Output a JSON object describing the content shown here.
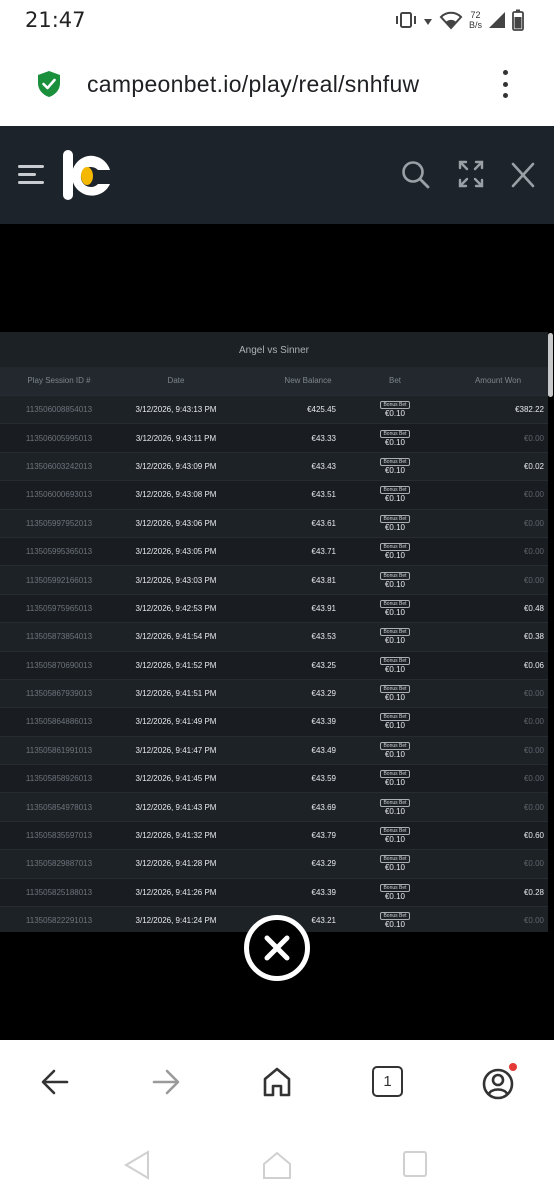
{
  "status": {
    "time": "21:47",
    "net_speed_top": "72",
    "net_speed_bottom": "B/s"
  },
  "browser": {
    "url": "campeonbet.io/play/real/snhfuw"
  },
  "modal": {
    "title": "Angel vs Sinner",
    "columns": [
      "Play Session ID #",
      "Date",
      "New Balance",
      "Bet",
      "Amount Won"
    ],
    "badge_label": "Bonus Bet",
    "rows": [
      {
        "id": "113506008854013",
        "date": "3/12/2026, 9:43:13 PM",
        "balance": "€425.45",
        "bet": "€0.10",
        "won": "€382.22"
      },
      {
        "id": "113506005995013",
        "date": "3/12/2026, 9:43:11 PM",
        "balance": "€43.33",
        "bet": "€0.10",
        "won": "€0.00"
      },
      {
        "id": "113506003242013",
        "date": "3/12/2026, 9:43:09 PM",
        "balance": "€43.43",
        "bet": "€0.10",
        "won": "€0.02"
      },
      {
        "id": "113506000693013",
        "date": "3/12/2026, 9:43:08 PM",
        "balance": "€43.51",
        "bet": "€0.10",
        "won": "€0.00"
      },
      {
        "id": "113505997952013",
        "date": "3/12/2026, 9:43:06 PM",
        "balance": "€43.61",
        "bet": "€0.10",
        "won": "€0.00"
      },
      {
        "id": "113505995365013",
        "date": "3/12/2026, 9:43:05 PM",
        "balance": "€43.71",
        "bet": "€0.10",
        "won": "€0.00"
      },
      {
        "id": "113505992166013",
        "date": "3/12/2026, 9:43:03 PM",
        "balance": "€43.81",
        "bet": "€0.10",
        "won": "€0.00"
      },
      {
        "id": "113505975965013",
        "date": "3/12/2026, 9:42:53 PM",
        "balance": "€43.91",
        "bet": "€0.10",
        "won": "€0.48"
      },
      {
        "id": "113505873854013",
        "date": "3/12/2026, 9:41:54 PM",
        "balance": "€43.53",
        "bet": "€0.10",
        "won": "€0.38"
      },
      {
        "id": "113505870690013",
        "date": "3/12/2026, 9:41:52 PM",
        "balance": "€43.25",
        "bet": "€0.10",
        "won": "€0.06"
      },
      {
        "id": "113505867939013",
        "date": "3/12/2026, 9:41:51 PM",
        "balance": "€43.29",
        "bet": "€0.10",
        "won": "€0.00"
      },
      {
        "id": "113505864886013",
        "date": "3/12/2026, 9:41:49 PM",
        "balance": "€43.39",
        "bet": "€0.10",
        "won": "€0.00"
      },
      {
        "id": "113505861991013",
        "date": "3/12/2026, 9:41:47 PM",
        "balance": "€43.49",
        "bet": "€0.10",
        "won": "€0.00"
      },
      {
        "id": "113505858926013",
        "date": "3/12/2026, 9:41:45 PM",
        "balance": "€43.59",
        "bet": "€0.10",
        "won": "€0.00"
      },
      {
        "id": "113505854978013",
        "date": "3/12/2026, 9:41:43 PM",
        "balance": "€43.69",
        "bet": "€0.10",
        "won": "€0.00"
      },
      {
        "id": "113505835597013",
        "date": "3/12/2026, 9:41:32 PM",
        "balance": "€43.79",
        "bet": "€0.10",
        "won": "€0.60"
      },
      {
        "id": "113505829887013",
        "date": "3/12/2026, 9:41:28 PM",
        "balance": "€43.29",
        "bet": "€0.10",
        "won": "€0.00"
      },
      {
        "id": "113505825188013",
        "date": "3/12/2026, 9:41:26 PM",
        "balance": "€43.39",
        "bet": "€0.10",
        "won": "€0.28"
      },
      {
        "id": "113505822291013",
        "date": "3/12/2026, 9:41:24 PM",
        "balance": "€43.21",
        "bet": "€0.10",
        "won": "€0.00"
      }
    ]
  },
  "colors": {
    "header_bg": "#1d232a",
    "logo_accent": "#f5b800",
    "shield_green": "#1a8f3c",
    "notify_dot": "#e53935"
  },
  "icons": [
    "wifi-icon",
    "vibrate-icon",
    "battery-icon",
    "shield-check-icon",
    "kebab-menu-icon",
    "hamburger-icon",
    "search-icon",
    "expand-icon",
    "close-icon",
    "back-icon",
    "forward-icon",
    "home-icon",
    "tabs-icon",
    "account-icon"
  ],
  "nav": {
    "tab_count": "1"
  }
}
